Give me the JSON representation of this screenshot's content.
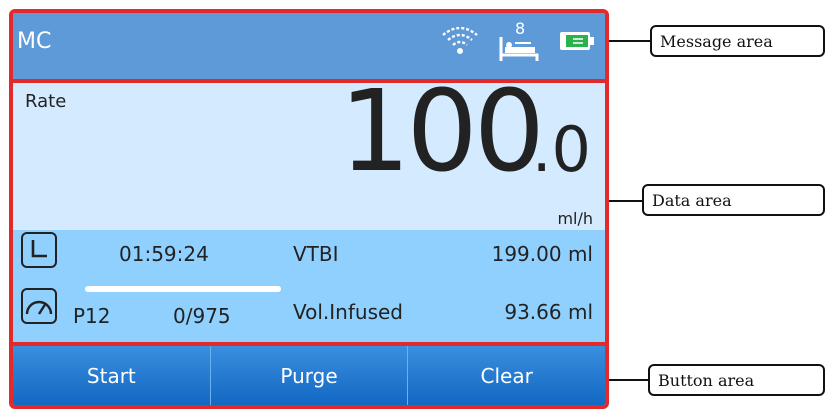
{
  "message_area": {
    "mode": "MC",
    "icons": [
      "wifi-icon",
      "patient-bed-icon",
      "battery-icon"
    ],
    "patient_number": "8"
  },
  "data_area": {
    "rate_label": "Rate",
    "rate_integer": "100",
    "rate_decimal": ".0",
    "unit": "ml/h"
  },
  "info_area": {
    "time": "01:59:24",
    "vtbi_label": "VTBI",
    "vtbi_value": "199.00 ml",
    "profile": "P12",
    "progress_text": "0/975",
    "vol_infused_label": "Vol.Infused",
    "vol_infused_value": "93.66 ml",
    "progress_fraction": 1.0
  },
  "buttons": {
    "start": "Start",
    "purge": "Purge",
    "clear": "Clear"
  },
  "callouts": {
    "message_area": "Message area",
    "data_area": "Data area",
    "button_area": "Button area"
  },
  "colors": {
    "frame": "#e32a2a",
    "message_bg": "#5f9ad8",
    "data_bg": "#d4ebff",
    "info_bg": "#90d0ff",
    "button_bg": "#1167c2",
    "battery_green": "#2bb24c"
  }
}
